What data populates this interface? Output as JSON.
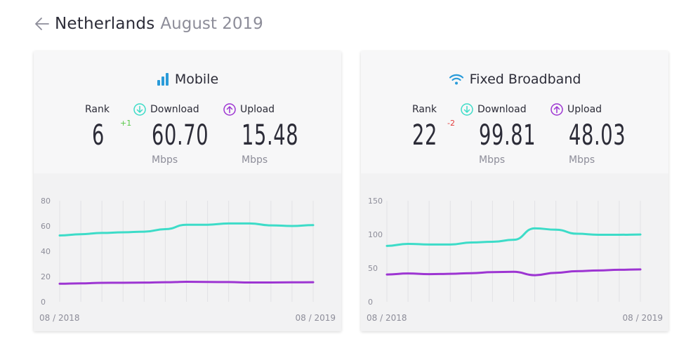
{
  "header": {
    "country": "Netherlands",
    "period": "August 2019"
  },
  "colors": {
    "download": "#3ddcc8",
    "upload": "#9d35d2",
    "mobile_icon": "#2a9bd9",
    "wifi_icon": "#2a9bd9",
    "rank_up": "#57c846",
    "rank_down": "#e23b3b"
  },
  "cards": [
    {
      "title": "Mobile",
      "icon": "signal-bars-icon",
      "rank_label": "Rank",
      "rank": "6",
      "rank_change": "+1",
      "download_label": "Download",
      "download": "60.70",
      "upload_label": "Upload",
      "upload": "15.48",
      "unit": "Mbps"
    },
    {
      "title": "Fixed Broadband",
      "icon": "wifi-icon",
      "rank_label": "Rank",
      "rank": "22",
      "rank_change": "-2",
      "download_label": "Download",
      "download": "99.81",
      "upload_label": "Upload",
      "upload": "48.03",
      "unit": "Mbps"
    }
  ],
  "chart_data": [
    {
      "type": "line",
      "x": [
        "08 / 2018",
        "09 / 2018",
        "10 / 2018",
        "11 / 2018",
        "12 / 2018",
        "01 / 2019",
        "02 / 2019",
        "03 / 2019",
        "04 / 2019",
        "05 / 2019",
        "06 / 2019",
        "07 / 2019",
        "08 / 2019"
      ],
      "x_tick_labels": [
        "08 / 2018",
        "08 / 2019"
      ],
      "ylim": [
        0,
        80
      ],
      "yticks": [
        0,
        20,
        40,
        60,
        80
      ],
      "grid": "vertical",
      "series": [
        {
          "name": "Download",
          "values": [
            52.5,
            53.5,
            54.5,
            55,
            55.5,
            57.5,
            61,
            61,
            62,
            62,
            60.5,
            60,
            60.7
          ]
        },
        {
          "name": "Upload",
          "values": [
            14.3,
            14.6,
            15.0,
            15.1,
            15.2,
            15.5,
            15.8,
            15.7,
            15.6,
            15.3,
            15.3,
            15.4,
            15.48
          ]
        }
      ]
    },
    {
      "type": "line",
      "x": [
        "08 / 2018",
        "09 / 2018",
        "10 / 2018",
        "11 / 2018",
        "12 / 2018",
        "01 / 2019",
        "02 / 2019",
        "03 / 2019",
        "04 / 2019",
        "05 / 2019",
        "06 / 2019",
        "07 / 2019",
        "08 / 2019"
      ],
      "x_tick_labels": [
        "08 / 2018",
        "08 / 2019"
      ],
      "ylim": [
        0,
        150
      ],
      "yticks": [
        0,
        50,
        100,
        150
      ],
      "grid": "vertical",
      "series": [
        {
          "name": "Download",
          "values": [
            83,
            86,
            85,
            85,
            88,
            89,
            92,
            109,
            107,
            101,
            99.5,
            99.5,
            99.81
          ]
        },
        {
          "name": "Upload",
          "values": [
            40.5,
            42,
            41,
            41.5,
            42.5,
            44,
            44.5,
            39.5,
            43,
            45.5,
            46.5,
            47.5,
            48.03
          ]
        }
      ]
    }
  ]
}
